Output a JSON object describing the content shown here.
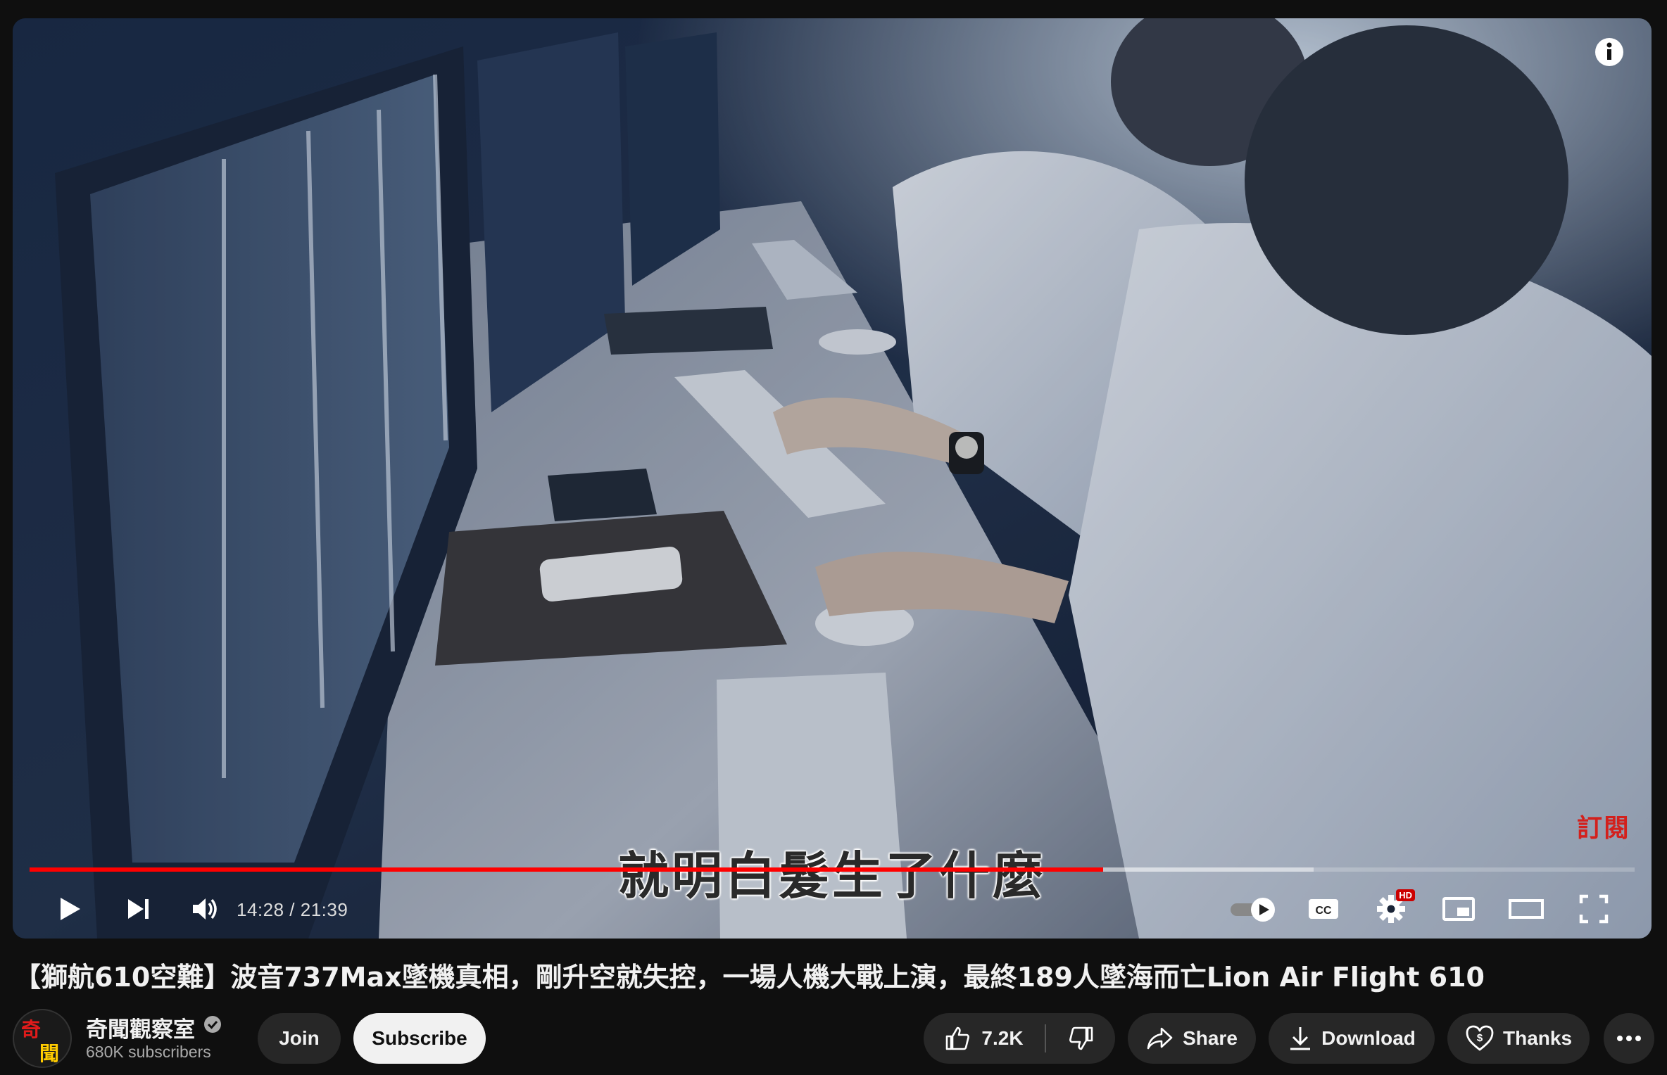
{
  "video": {
    "subtitle": "就明白髮生了什麼",
    "corner_watermark": "訂閱",
    "current_time": "14:28",
    "duration": "21:39",
    "time_display": "14:28 / 21:39",
    "progress_fraction": 0.669,
    "buffered_fraction": 0.8,
    "hd_badge": "HD",
    "cc_label": "CC"
  },
  "icons": {
    "info": "info-icon",
    "play": "play-icon",
    "next": "next-icon",
    "volume": "volume-icon",
    "autoplay": "autoplay-toggle-icon",
    "captions": "cc-icon",
    "settings": "gear-icon",
    "miniplayer": "miniplayer-icon",
    "theater": "theater-mode-icon",
    "fullscreen": "fullscreen-icon",
    "like": "thumbs-up-icon",
    "dislike": "thumbs-down-icon",
    "share": "share-icon",
    "download": "download-icon",
    "thanks": "thanks-heart-icon",
    "more": "more-dots-icon",
    "verified": "verified-check-icon"
  },
  "title": "【獅航610空難】波音737Max墜機真相，剛升空就失控，一場人機大戰上演，最終189人墜海而亡Lion Air Flight 610",
  "channel": {
    "avatar_top": "奇",
    "avatar_bottom": "聞",
    "name": "奇聞觀察室",
    "subscribers": "680K subscribers"
  },
  "actions": {
    "join": "Join",
    "subscribe": "Subscribe",
    "likes": "7.2K",
    "share": "Share",
    "download": "Download",
    "thanks": "Thanks"
  },
  "colors": {
    "progress": "#ff0000",
    "background": "#0f0f0f",
    "pill": "#272727"
  }
}
